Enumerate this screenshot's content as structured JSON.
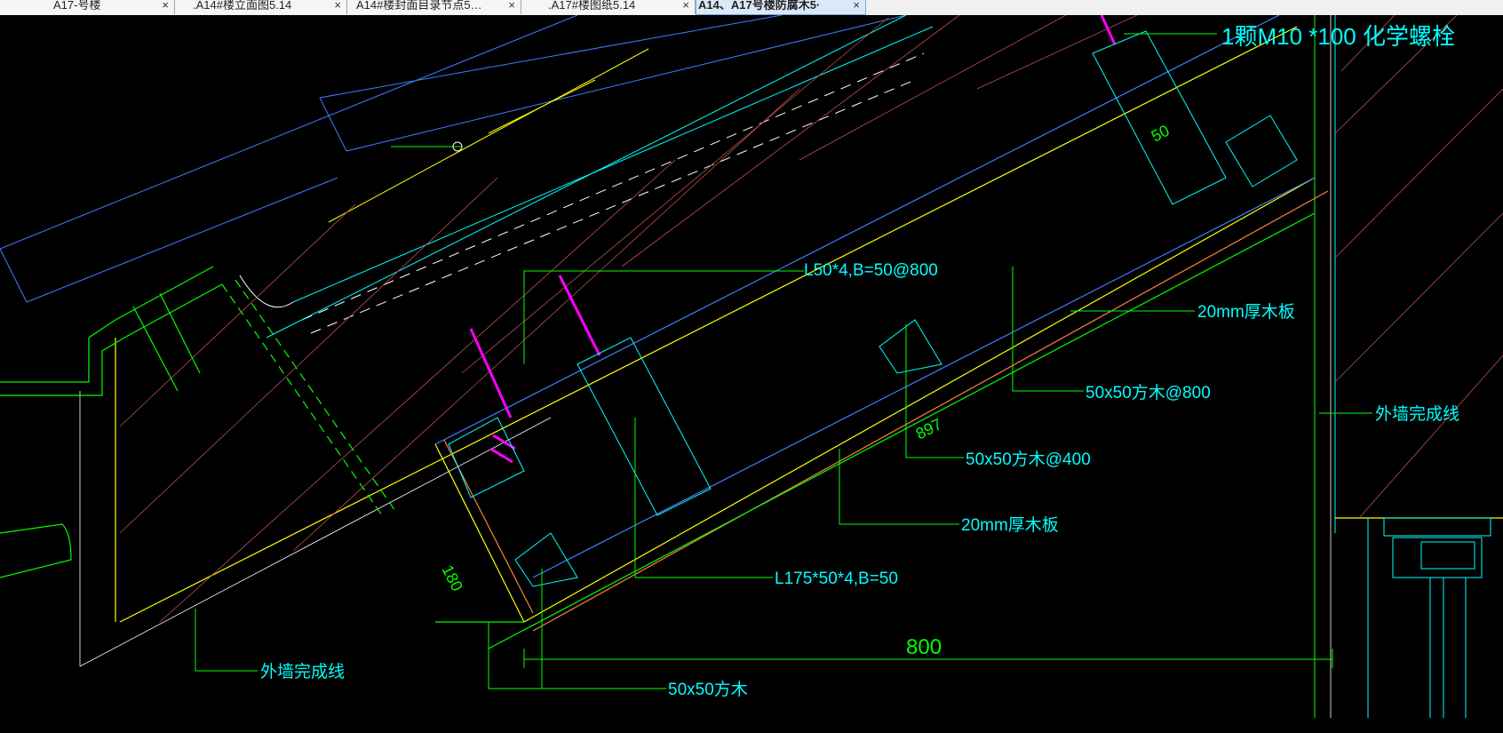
{
  "tabs": [
    {
      "label": "A17-号楼",
      "close": "×",
      "active": false
    },
    {
      "label": ".A14#楼立面图5.14",
      "close": "×",
      "active": false
    },
    {
      "label": "A14#楼封面目录节点5…",
      "close": "×",
      "active": false
    },
    {
      "label": ".A17#楼图纸5.14",
      "close": "×",
      "active": false
    },
    {
      "label": "A14、A17号楼防腐木5·",
      "close": "×",
      "active": true
    }
  ],
  "annotations": {
    "bolt": "1颗M10 *100 化学螺栓",
    "angle_top": "L50*4,B=50@800",
    "board_right": "20mm厚木板",
    "timber_800": "50x50方木@800",
    "timber_400": "50x50方木@400",
    "board_bottom": "20mm厚木板",
    "angle_bottom": "L175*50*4,B=50",
    "timber_bottom": "50x50方木",
    "wall_left": "外墙完成线",
    "wall_right": "外墙完成线"
  },
  "dimensions": {
    "d50": "50",
    "d897": "897",
    "d180": "180",
    "d800": "800"
  },
  "colors": {
    "canvas_bg": "#000000",
    "green": "#00ff00",
    "cyan": "#00ffff",
    "yellow": "#ffff00",
    "orange": "#ff8040",
    "blue": "#3f7fff",
    "magenta": "#ff00ff",
    "white": "#ffffff",
    "hatch": "#c0504d"
  }
}
